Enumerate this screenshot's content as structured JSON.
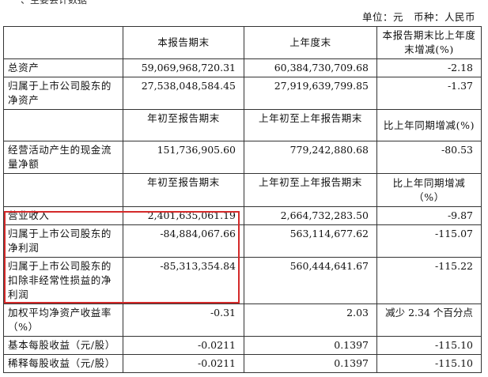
{
  "cut_heading": "一、主要会计数据",
  "unit": {
    "label": "单位：元　币种：人民币"
  },
  "columns": {
    "period_end": "本报告期末",
    "prior_year_end": "上年度末",
    "change_vs_year_end": "本报告期末比上年度末增减(%)"
  },
  "balance_rows": [
    {
      "label": "总资产",
      "current": "59,069,968,720.31",
      "prior": "60,384,730,709.68",
      "change": "-2.18"
    },
    {
      "label": "归属于上市公司股东的净资产",
      "current": "27,538,048,584.45",
      "prior": "27,919,639,799.85",
      "change": "-1.37"
    }
  ],
  "cash_header": {
    "ytd": "年初至报告期末",
    "prior_ytd": "上年初至上年报告期末",
    "yoy": "比上年同期增减(%)"
  },
  "cash_rows": [
    {
      "label": "经营活动产生的现金流量净额",
      "current": "151,736,905.60",
      "prior": "779,242,880.68",
      "change": "-80.53"
    }
  ],
  "income_header": {
    "ytd": "年初至报告期末",
    "prior_ytd": "上年初至上年报告期末",
    "yoy": "比上年同期增减（%）"
  },
  "income_rows": [
    {
      "label": "营业收入",
      "current": "2,401,635,061.19",
      "prior": "2,664,732,283.50",
      "change": "-9.87"
    },
    {
      "label": "归属于上市公司股东的净利润",
      "current": "-84,884,067.66",
      "prior": "563,114,677.62",
      "change": "-115.07"
    },
    {
      "label": "归属于上市公司股东的扣除非经常性损益的净利润",
      "current": "-85,313,354.84",
      "prior": "560,444,641.67",
      "change": "-115.22"
    },
    {
      "label": "加权平均净资产收益率（%）",
      "current": "-0.31",
      "prior": "2.03",
      "change": "减少 2.34 个百分点"
    },
    {
      "label": "基本每股收益（元/股）",
      "current": "-0.0211",
      "prior": "0.1397",
      "change": "-115.10"
    },
    {
      "label": "稀释每股收益（元/股）",
      "current": "-0.0211",
      "prior": "0.1397",
      "change": "-115.10"
    }
  ],
  "highlight_color": "#d42a2a"
}
